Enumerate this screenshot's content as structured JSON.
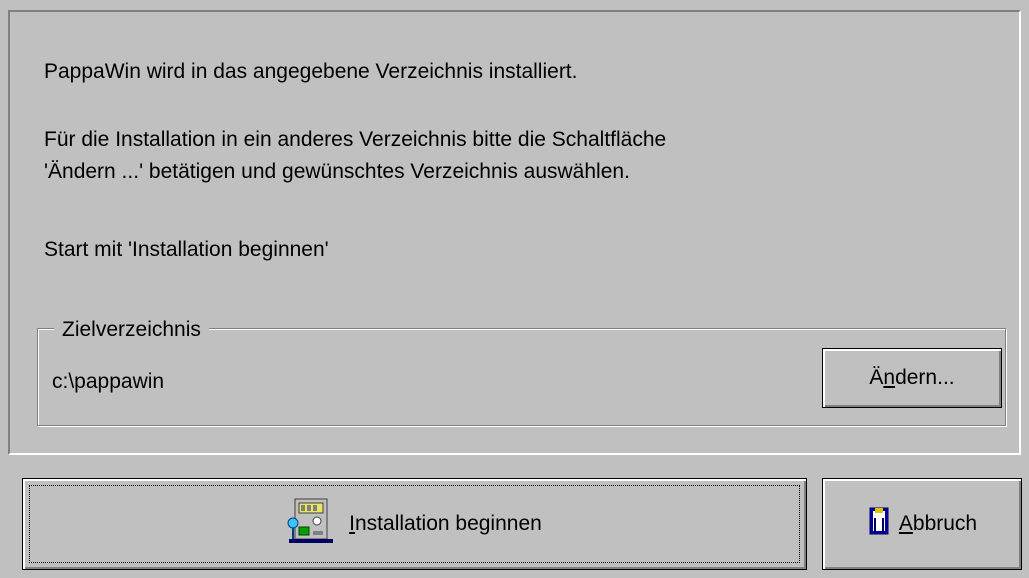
{
  "info": {
    "line1": "PappaWin wird in das angegebene Verzeichnis installiert.",
    "line2": "Für die Installation in ein anderes Verzeichnis bitte die Schaltfläche",
    "line3": "'Ändern ...' betätigen und gewünschtes Verzeichnis auswählen.",
    "line4": "Start mit 'Installation beginnen'"
  },
  "target_group": {
    "legend": "Zielverzeichnis",
    "path": "c:\\pappawin",
    "change_button": {
      "mnemonic_before": "Ä",
      "mnemonic": "n",
      "mnemonic_after": "dern..."
    }
  },
  "buttons": {
    "install": {
      "mnemonic": "I",
      "rest": "nstallation beginnen",
      "icon": "computer-setup-icon"
    },
    "abort": {
      "mnemonic": "A",
      "rest": "bbruch",
      "icon": "exit-door-icon"
    }
  },
  "colors": {
    "face": "#c0c0c0",
    "highlight": "#ffffff",
    "shadow": "#808080"
  }
}
